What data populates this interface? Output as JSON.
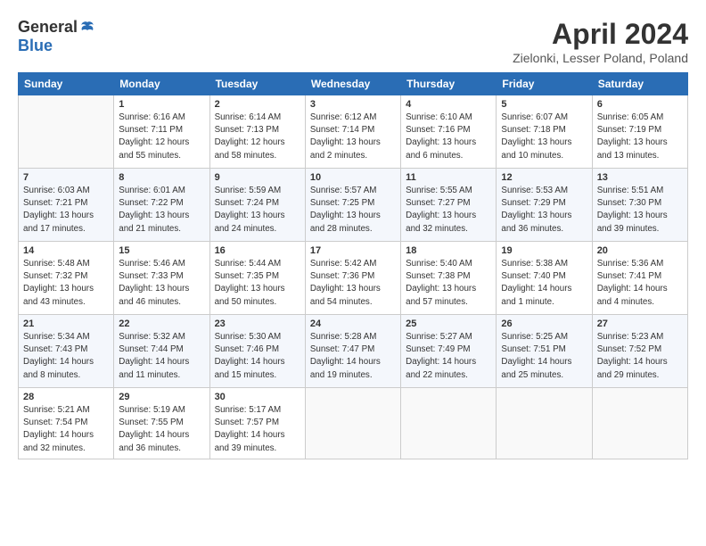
{
  "header": {
    "logo_general": "General",
    "logo_blue": "Blue",
    "title": "April 2024",
    "location": "Zielonki, Lesser Poland, Poland"
  },
  "days_of_week": [
    "Sunday",
    "Monday",
    "Tuesday",
    "Wednesday",
    "Thursday",
    "Friday",
    "Saturday"
  ],
  "weeks": [
    [
      {
        "day": "",
        "info": ""
      },
      {
        "day": "1",
        "info": "Sunrise: 6:16 AM\nSunset: 7:11 PM\nDaylight: 12 hours\nand 55 minutes."
      },
      {
        "day": "2",
        "info": "Sunrise: 6:14 AM\nSunset: 7:13 PM\nDaylight: 12 hours\nand 58 minutes."
      },
      {
        "day": "3",
        "info": "Sunrise: 6:12 AM\nSunset: 7:14 PM\nDaylight: 13 hours\nand 2 minutes."
      },
      {
        "day": "4",
        "info": "Sunrise: 6:10 AM\nSunset: 7:16 PM\nDaylight: 13 hours\nand 6 minutes."
      },
      {
        "day": "5",
        "info": "Sunrise: 6:07 AM\nSunset: 7:18 PM\nDaylight: 13 hours\nand 10 minutes."
      },
      {
        "day": "6",
        "info": "Sunrise: 6:05 AM\nSunset: 7:19 PM\nDaylight: 13 hours\nand 13 minutes."
      }
    ],
    [
      {
        "day": "7",
        "info": "Sunrise: 6:03 AM\nSunset: 7:21 PM\nDaylight: 13 hours\nand 17 minutes."
      },
      {
        "day": "8",
        "info": "Sunrise: 6:01 AM\nSunset: 7:22 PM\nDaylight: 13 hours\nand 21 minutes."
      },
      {
        "day": "9",
        "info": "Sunrise: 5:59 AM\nSunset: 7:24 PM\nDaylight: 13 hours\nand 24 minutes."
      },
      {
        "day": "10",
        "info": "Sunrise: 5:57 AM\nSunset: 7:25 PM\nDaylight: 13 hours\nand 28 minutes."
      },
      {
        "day": "11",
        "info": "Sunrise: 5:55 AM\nSunset: 7:27 PM\nDaylight: 13 hours\nand 32 minutes."
      },
      {
        "day": "12",
        "info": "Sunrise: 5:53 AM\nSunset: 7:29 PM\nDaylight: 13 hours\nand 36 minutes."
      },
      {
        "day": "13",
        "info": "Sunrise: 5:51 AM\nSunset: 7:30 PM\nDaylight: 13 hours\nand 39 minutes."
      }
    ],
    [
      {
        "day": "14",
        "info": "Sunrise: 5:48 AM\nSunset: 7:32 PM\nDaylight: 13 hours\nand 43 minutes."
      },
      {
        "day": "15",
        "info": "Sunrise: 5:46 AM\nSunset: 7:33 PM\nDaylight: 13 hours\nand 46 minutes."
      },
      {
        "day": "16",
        "info": "Sunrise: 5:44 AM\nSunset: 7:35 PM\nDaylight: 13 hours\nand 50 minutes."
      },
      {
        "day": "17",
        "info": "Sunrise: 5:42 AM\nSunset: 7:36 PM\nDaylight: 13 hours\nand 54 minutes."
      },
      {
        "day": "18",
        "info": "Sunrise: 5:40 AM\nSunset: 7:38 PM\nDaylight: 13 hours\nand 57 minutes."
      },
      {
        "day": "19",
        "info": "Sunrise: 5:38 AM\nSunset: 7:40 PM\nDaylight: 14 hours\nand 1 minute."
      },
      {
        "day": "20",
        "info": "Sunrise: 5:36 AM\nSunset: 7:41 PM\nDaylight: 14 hours\nand 4 minutes."
      }
    ],
    [
      {
        "day": "21",
        "info": "Sunrise: 5:34 AM\nSunset: 7:43 PM\nDaylight: 14 hours\nand 8 minutes."
      },
      {
        "day": "22",
        "info": "Sunrise: 5:32 AM\nSunset: 7:44 PM\nDaylight: 14 hours\nand 11 minutes."
      },
      {
        "day": "23",
        "info": "Sunrise: 5:30 AM\nSunset: 7:46 PM\nDaylight: 14 hours\nand 15 minutes."
      },
      {
        "day": "24",
        "info": "Sunrise: 5:28 AM\nSunset: 7:47 PM\nDaylight: 14 hours\nand 19 minutes."
      },
      {
        "day": "25",
        "info": "Sunrise: 5:27 AM\nSunset: 7:49 PM\nDaylight: 14 hours\nand 22 minutes."
      },
      {
        "day": "26",
        "info": "Sunrise: 5:25 AM\nSunset: 7:51 PM\nDaylight: 14 hours\nand 25 minutes."
      },
      {
        "day": "27",
        "info": "Sunrise: 5:23 AM\nSunset: 7:52 PM\nDaylight: 14 hours\nand 29 minutes."
      }
    ],
    [
      {
        "day": "28",
        "info": "Sunrise: 5:21 AM\nSunset: 7:54 PM\nDaylight: 14 hours\nand 32 minutes."
      },
      {
        "day": "29",
        "info": "Sunrise: 5:19 AM\nSunset: 7:55 PM\nDaylight: 14 hours\nand 36 minutes."
      },
      {
        "day": "30",
        "info": "Sunrise: 5:17 AM\nSunset: 7:57 PM\nDaylight: 14 hours\nand 39 minutes."
      },
      {
        "day": "",
        "info": ""
      },
      {
        "day": "",
        "info": ""
      },
      {
        "day": "",
        "info": ""
      },
      {
        "day": "",
        "info": ""
      }
    ]
  ]
}
